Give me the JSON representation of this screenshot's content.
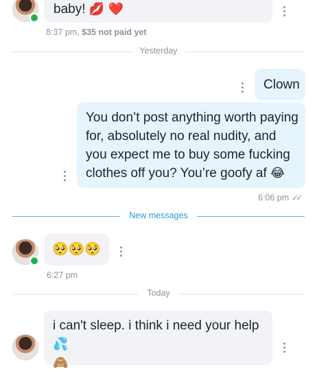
{
  "messages": {
    "m1": {
      "text": "baby!",
      "emoji": "💋 ❤️",
      "time": "8:37 pm,",
      "status": "$35 not paid yet"
    },
    "m2": {
      "text": "Clown"
    },
    "m3": {
      "text": "You don’t post anything worth paying for, absolutely no real nudity, and you expect me to buy some fucking clothes off you? You’re goofy af",
      "emoji": "😂",
      "time": "6:06 pm"
    },
    "m4": {
      "emoji": "🥺🥺🥺",
      "time": "6:27 pm"
    },
    "m5": {
      "text": "i can't sleep. i think i need your help",
      "emoji": "💦",
      "emoji2": "🙈"
    }
  },
  "dividers": {
    "yesterday": "Yesterday",
    "new_messages": "New messages",
    "today": "Today"
  },
  "colors": {
    "incoming_bubble": "#f1f3f6",
    "outgoing_bubble": "#e6f4fd",
    "accent": "#2b9bd8",
    "online": "#22b14c"
  }
}
